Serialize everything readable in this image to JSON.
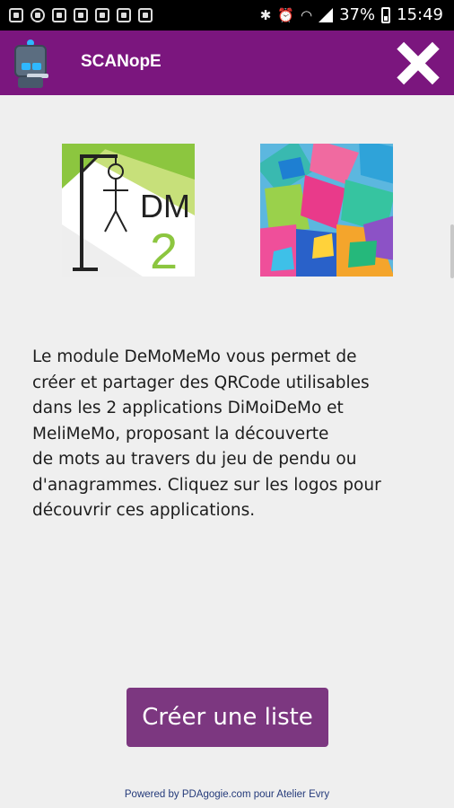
{
  "status_bar": {
    "battery": "37%",
    "time": "15:49"
  },
  "app_bar": {
    "title": "SCANopE"
  },
  "logos": [
    {
      "name": "DiMoiDeMo",
      "text": "DM",
      "number": "2"
    },
    {
      "name": "MeliMeMo"
    }
  ],
  "description": {
    "lines": [
      "Le module DeMoMeMo vous permet de",
      "créer et partager des QRCode utilisables",
      "dans les 2 applications DiMoiDeMo et",
      "MeliMeMo, proposant la découverte",
      "de mots au travers du jeu de pendu ou",
      "d'anagrammes. Cliquez sur les logos pour",
      "découvrir ces applications."
    ]
  },
  "actions": {
    "create_label": "Créer une liste"
  },
  "footer": {
    "text": "Powered by PDAgogie.com pour Atelier Evry"
  },
  "colors": {
    "app_bar": "#7b167e",
    "button": "#7c3780",
    "background": "#efefef"
  }
}
